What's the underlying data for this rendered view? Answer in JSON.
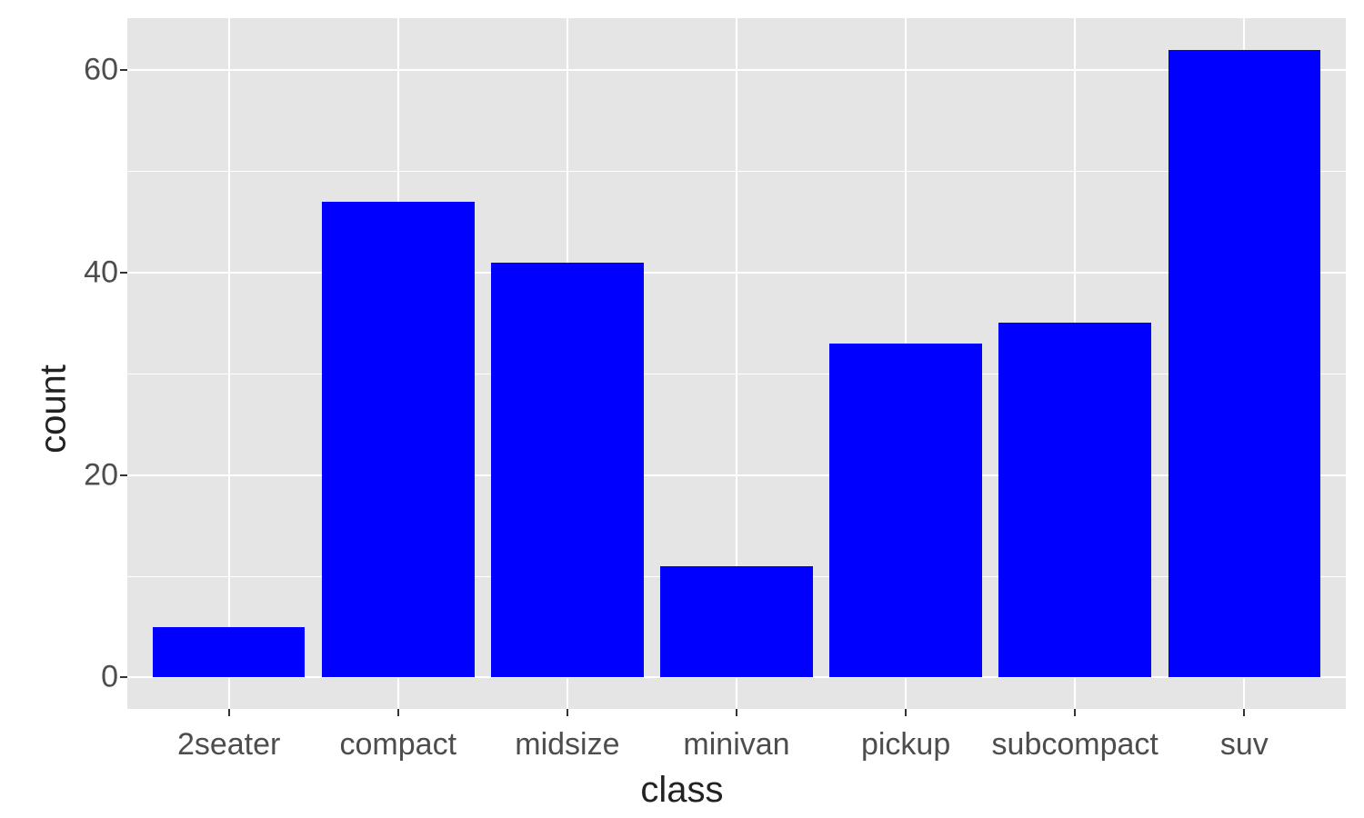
{
  "chart_data": {
    "type": "bar",
    "categories": [
      "2seater",
      "compact",
      "midsize",
      "minivan",
      "pickup",
      "subcompact",
      "suv"
    ],
    "values": [
      5,
      47,
      41,
      11,
      33,
      35,
      62
    ],
    "title": "",
    "xlabel": "class",
    "ylabel": "count",
    "ylim": [
      0,
      65
    ],
    "y_ticks": [
      0,
      20,
      40,
      60
    ],
    "y_minor": [
      10,
      30,
      50
    ],
    "bar_fill": "#0000ff",
    "panel_bg": "#E5E5E5"
  }
}
